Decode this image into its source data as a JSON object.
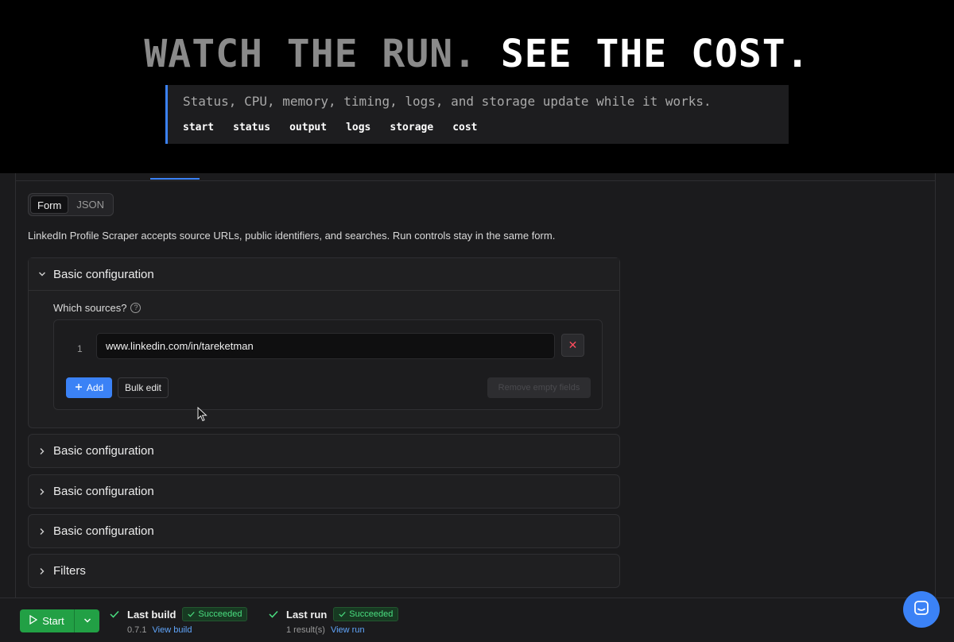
{
  "hero": {
    "title_dim": "WATCH THE RUN.",
    "title_bright": "SEE THE COST.",
    "subtitle": "Status, CPU, memory, timing, logs, and storage update while it works.",
    "tags": [
      "start",
      "status",
      "output",
      "logs",
      "storage",
      "cost"
    ]
  },
  "input_mode": {
    "options": [
      "Form",
      "JSON"
    ],
    "active": "Form"
  },
  "intro_text": "LinkedIn Profile Scraper accepts source URLs, public identifiers, and searches. Run controls stay in the same form.",
  "sections": [
    {
      "title": "Basic configuration",
      "expanded": true
    },
    {
      "title": "Basic configuration",
      "expanded": false
    },
    {
      "title": "Basic configuration",
      "expanded": false
    },
    {
      "title": "Basic configuration",
      "expanded": false
    },
    {
      "title": "Filters",
      "expanded": false
    }
  ],
  "sources": {
    "label": "Which sources?",
    "help_glyph": "?",
    "rows": [
      {
        "index": "1",
        "value": "www.linkedin.com/in/tareketman"
      }
    ],
    "remove_glyph": "✕",
    "add_label": "Add",
    "bulk_edit_label": "Bulk edit",
    "remove_empty_label": "Remove empty fields"
  },
  "bottom_bar": {
    "start_label": "Start",
    "last_build": {
      "label": "Last build",
      "status": "Succeeded",
      "version": "0.7.1",
      "link": "View build"
    },
    "last_run": {
      "label": "Last run",
      "status": "Succeeded",
      "results": "1 result(s)",
      "link": "View run"
    }
  },
  "colors": {
    "accent": "#3b82f6",
    "start_green": "#22a045",
    "success_text": "#4ade80",
    "danger": "#ff4d5e"
  }
}
